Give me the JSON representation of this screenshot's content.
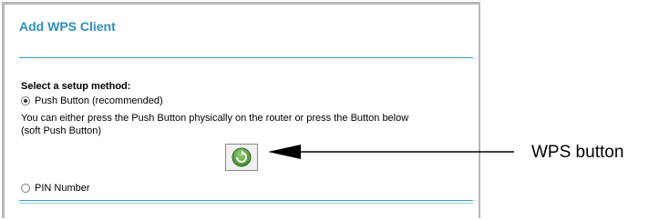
{
  "panel": {
    "title": "Add WPS Client",
    "setup_method_label": "Select a setup method:",
    "push_button_option": "Push Button (recommended)",
    "push_button_description_line1": "You can either press the Push Button physically on the router or press the Button below",
    "push_button_description_line2": "(soft Push Button)",
    "pin_option": "PIN Number"
  },
  "annotation": {
    "label": "WPS button"
  },
  "selected_method": "push_button",
  "colors": {
    "title": "#2f8fbf",
    "rule": "#3a9bc7",
    "button_green": "#4a9a36"
  }
}
